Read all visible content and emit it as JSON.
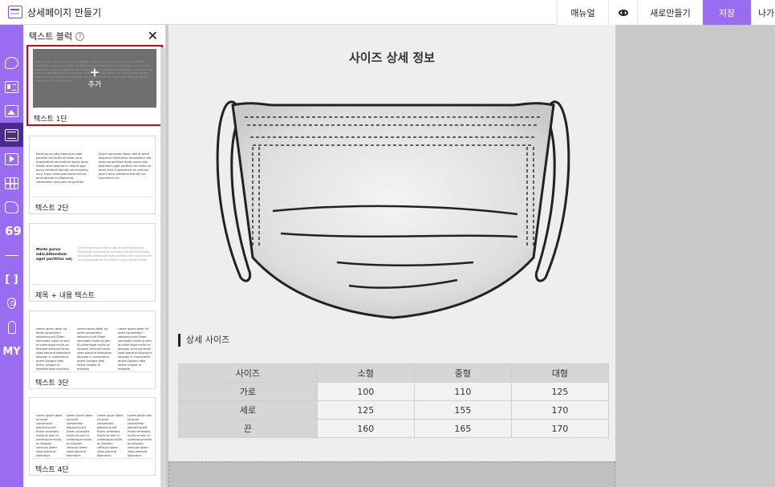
{
  "app": {
    "title": "상세페이지 만들기"
  },
  "toolbar": {
    "manual_label": "매뉴얼",
    "preview_icon": "eye-icon",
    "new_label": "새로만들기",
    "save_label": "저장",
    "exit_label": "나가기",
    "accent_color": "#9a6df0"
  },
  "rail": {
    "items": [
      {
        "icon": "palette-icon"
      },
      {
        "icon": "image-text-icon"
      },
      {
        "icon": "image-icon"
      },
      {
        "icon": "text-block-icon",
        "active": true
      },
      {
        "icon": "video-icon"
      },
      {
        "icon": "table-icon"
      },
      {
        "icon": "shape-icon"
      },
      {
        "icon": "quote-icon"
      },
      {
        "icon": "divider-icon"
      },
      {
        "icon": "bracket-icon",
        "label": "[ ]"
      },
      {
        "icon": "map-pin-icon"
      },
      {
        "icon": "wrench-icon"
      },
      {
        "icon": "my-icon",
        "label": "MY"
      }
    ]
  },
  "panel": {
    "title": "텍스트 블럭",
    "help_icon": "?",
    "blocks": [
      {
        "label": "텍스트 1단",
        "add_label": "추가",
        "selected": true
      },
      {
        "label": "텍스트 2단"
      },
      {
        "label": "제목 + 내용 텍스트",
        "thumb_heading": "Morbi purus odio,bibendum eget porttitor vel,"
      },
      {
        "label": "텍스트 3단"
      },
      {
        "label": "텍스트 4단"
      }
    ]
  },
  "canvas": {
    "page_title": "사이즈 상세 정보",
    "section_title": "상세 사이즈",
    "table": {
      "headers": [
        "사이즈",
        "소형",
        "중형",
        "대형"
      ],
      "rows": [
        [
          "가로",
          "100",
          "110",
          "125"
        ],
        [
          "세로",
          "125",
          "155",
          "170"
        ],
        [
          "끈",
          "160",
          "165",
          "170"
        ]
      ]
    }
  }
}
